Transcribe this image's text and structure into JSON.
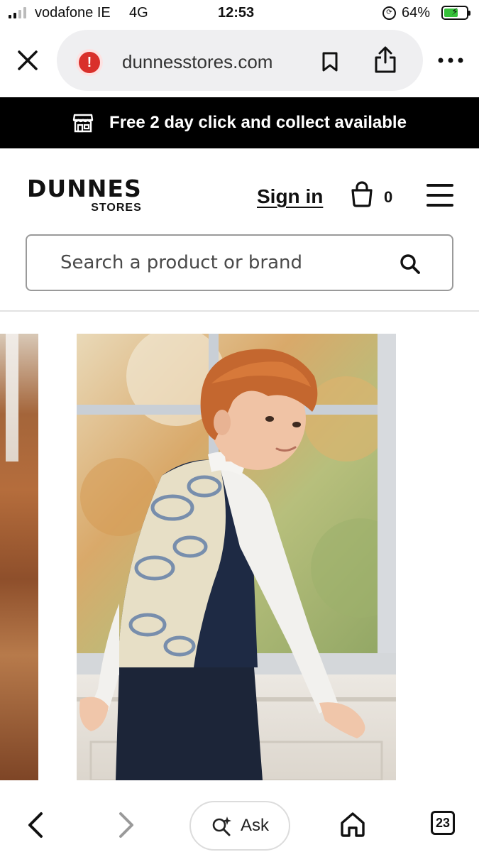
{
  "status_bar": {
    "carrier": "vodafone IE",
    "network": "4G",
    "time": "12:53",
    "battery_percent": "64%",
    "battery_level": 0.64,
    "battery_color": "#36c23a"
  },
  "browser": {
    "url": "dunnesstores.com",
    "warning_color": "#d9302b",
    "warning_glyph": "!",
    "icons": [
      "close-icon",
      "security-warning-icon",
      "bookmark-icon",
      "share-icon",
      "more-icon"
    ]
  },
  "promo": {
    "text": "Free 2 day click and collect available",
    "icon": "store-icon"
  },
  "header": {
    "logo_main": "DUNNES",
    "logo_sub": "STORES",
    "sign_in": "Sign in",
    "bag_count": "0"
  },
  "search": {
    "placeholder": "Search a product or brand"
  },
  "bottom_bar": {
    "ask_label": "Ask",
    "tab_count": "23",
    "icons": [
      "back-icon",
      "forward-icon",
      "ask-sparkle-icon",
      "home-icon",
      "tabs-icon"
    ]
  }
}
